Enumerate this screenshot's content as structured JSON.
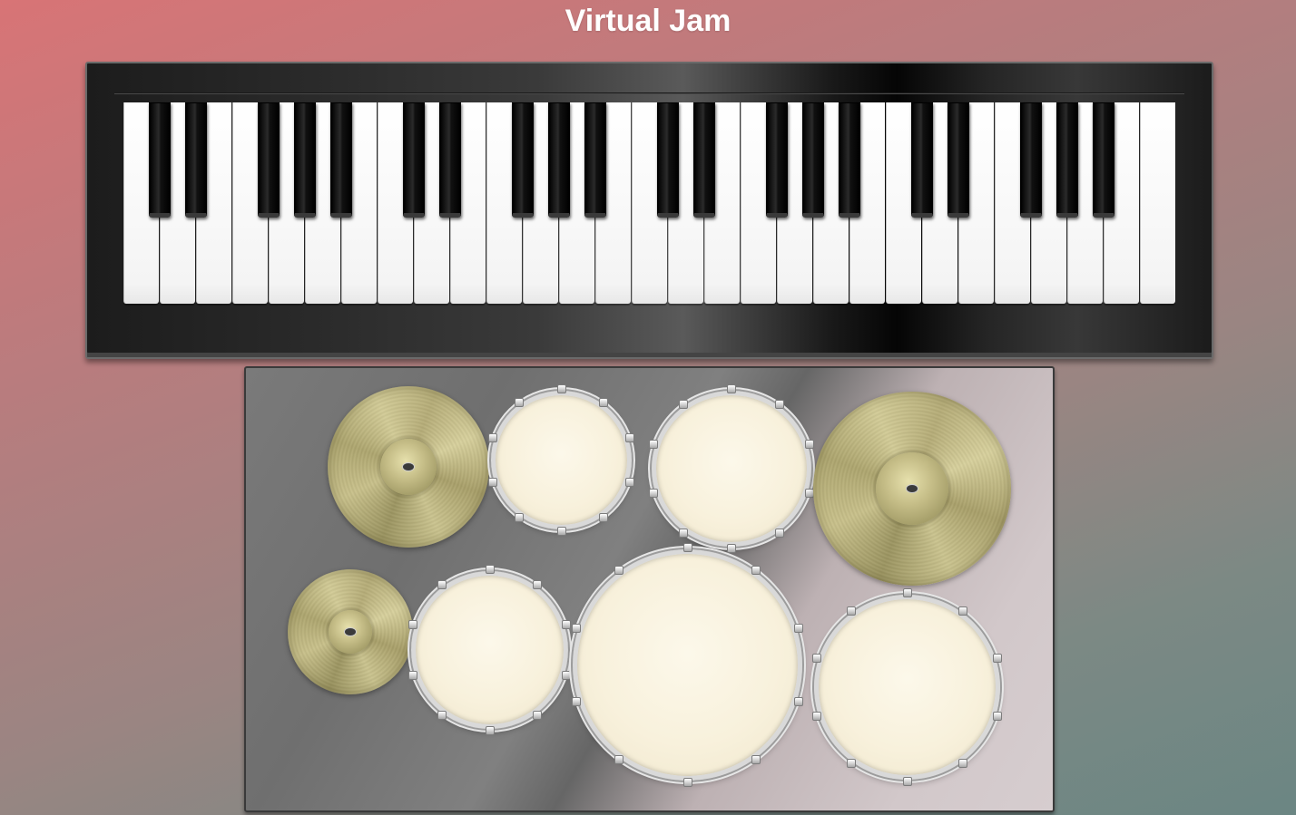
{
  "app": {
    "title": "Virtual Jam"
  },
  "piano": {
    "white_key_count": 29,
    "black_key_count": 20
  },
  "drumkit": {
    "cymbals": [
      {
        "name": "crash-cymbal-left"
      },
      {
        "name": "ride-cymbal-right"
      },
      {
        "name": "hihat-cymbal"
      }
    ],
    "drums": [
      {
        "name": "tom-high"
      },
      {
        "name": "tom-mid"
      },
      {
        "name": "tom-left"
      },
      {
        "name": "bass-drum"
      },
      {
        "name": "floor-tom"
      }
    ]
  },
  "colors": {
    "background_start": "#d87476",
    "background_end": "#6b8683",
    "title": "#ffffff",
    "drum_head": "#f8f1dc",
    "cymbal": "#b6ad78"
  }
}
